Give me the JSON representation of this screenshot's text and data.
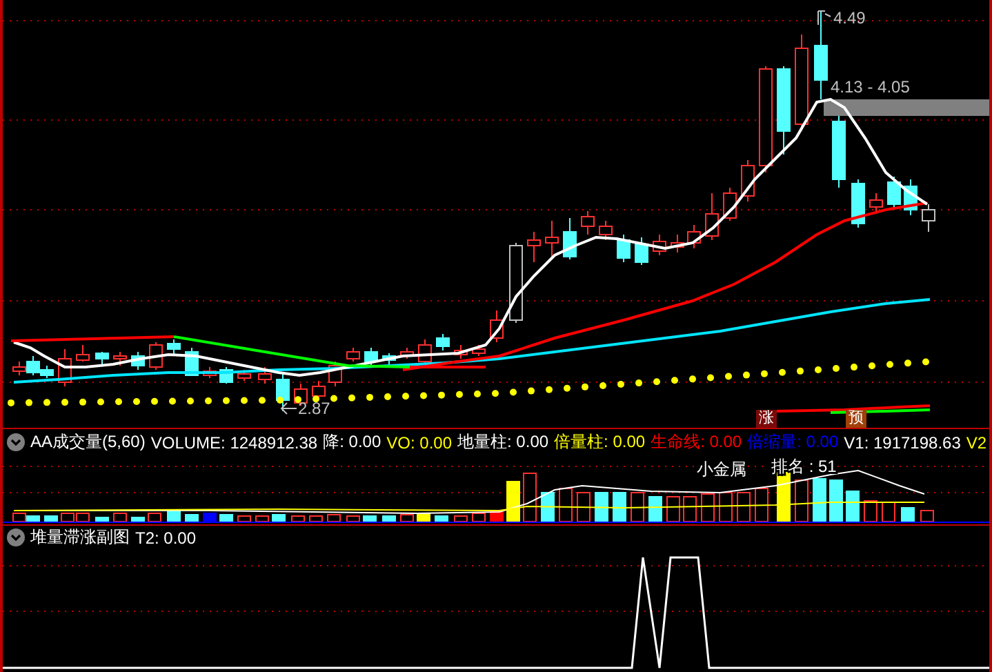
{
  "main_chart": {
    "high_label": "4.49",
    "range_label": "4.13 - 4.05",
    "low_label": "2.87",
    "signals": [
      {
        "text": "涨",
        "kind": "rise"
      },
      {
        "text": "预",
        "kind": "forecast"
      }
    ]
  },
  "volume_panel": {
    "title": "AA成交量(5,60)",
    "readings": [
      {
        "text": "VOLUME: 1248912.38",
        "color": "#ffffff"
      },
      {
        "text": "降: 0.00",
        "color": "#ffffff"
      },
      {
        "text": "VO: 0.00",
        "color": "#ffff00"
      },
      {
        "text": "地量柱: 0.00",
        "color": "#ffffff"
      },
      {
        "text": "倍量柱: 0.00",
        "color": "#ffff00"
      },
      {
        "text": "生命线: 0.00",
        "color": "#ff0000"
      },
      {
        "text": "倍缩量: 0.00",
        "color": "#0000ff"
      },
      {
        "text": "V1: 1917198.63",
        "color": "#ffffff"
      },
      {
        "text": "V2",
        "color": "#ffff00"
      }
    ],
    "sector": "小金属",
    "rank": "排名 : 51"
  },
  "sub_panel": {
    "title": "堆量滞涨副图",
    "readings": [
      {
        "text": "T2: 0.00",
        "color": "#ffffff"
      }
    ]
  }
}
